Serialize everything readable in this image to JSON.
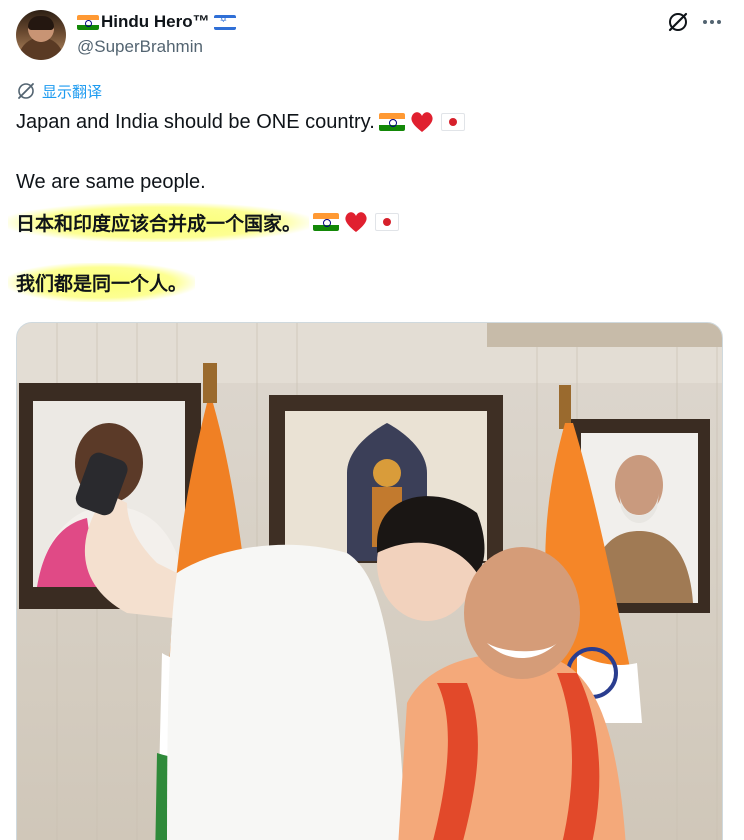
{
  "author": {
    "display_name": "Hindu Hero™",
    "handle": "@SuperBrahmin",
    "name_emoji": [
      "india-flag",
      "israel-flag"
    ]
  },
  "header_icons": [
    "grok-icon",
    "more-icon"
  ],
  "translate": {
    "label": "显示翻译",
    "icon": "translate-icon"
  },
  "tweet": {
    "line1": "Japan and India should be ONE country.",
    "line2": "We are same people.",
    "line3": "日本和印度应该合并成一个国家。",
    "line4": "我们都是同一个人。",
    "emoji": [
      "india-flag",
      "red-heart",
      "japan-flag"
    ]
  },
  "colors": {
    "accent": "#1d9bf0",
    "text": "#0f1419",
    "secondary": "#536471",
    "highlight": "#fcff6e"
  }
}
